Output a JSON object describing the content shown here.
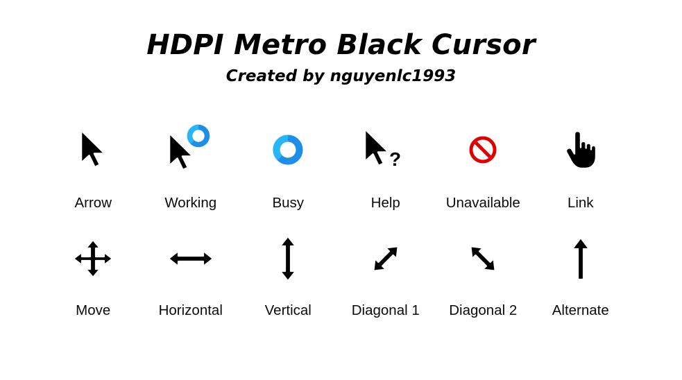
{
  "header": {
    "title": "HDPI Metro Black Cursor",
    "subtitle": "Created by nguyenlc1993"
  },
  "colors": {
    "background": "#ffffff",
    "cursor_fill": "#000000",
    "cursor_outline": "#ffffff",
    "busy_blue": "#1e8fe8",
    "busy_blue_light": "#29b6f6",
    "unavailable_red": "#e00000",
    "text": "#000000"
  },
  "rows": [
    {
      "cells": [
        {
          "icon": "arrow-cursor-icon",
          "label": "Arrow"
        },
        {
          "icon": "working-cursor-icon",
          "label": "Working"
        },
        {
          "icon": "busy-cursor-icon",
          "label": "Busy"
        },
        {
          "icon": "help-cursor-icon",
          "label": "Help"
        },
        {
          "icon": "unavailable-cursor-icon",
          "label": "Unavailable"
        },
        {
          "icon": "link-hand-cursor-icon",
          "label": "Link"
        }
      ]
    },
    {
      "cells": [
        {
          "icon": "move-cursor-icon",
          "label": "Move"
        },
        {
          "icon": "resize-horizontal-cursor-icon",
          "label": "Horizontal"
        },
        {
          "icon": "resize-vertical-cursor-icon",
          "label": "Vertical"
        },
        {
          "icon": "resize-diagonal-1-cursor-icon",
          "label": "Diagonal 1"
        },
        {
          "icon": "resize-diagonal-2-cursor-icon",
          "label": "Diagonal 2"
        },
        {
          "icon": "alternate-select-cursor-icon",
          "label": "Alternate"
        }
      ]
    }
  ]
}
